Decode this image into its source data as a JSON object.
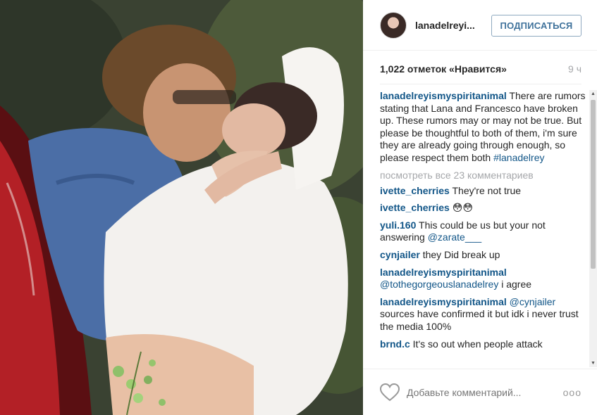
{
  "post": {
    "username": "lanadelreyi...",
    "follow_label": "ПОДПИСАТЬСЯ",
    "likes_text": "1,022 отметок «Нравится»",
    "time_ago": "9 ч"
  },
  "caption": {
    "user": "lanadelreyismyspiritanimal",
    "text": " There are rumors stating that Lana and Francesco have broken up. These rumors may or may not be true. But please be thoughtful to both of them, i'm sure they are already going through enough, so please respect them both ",
    "hashtag": "#lanadelrey"
  },
  "view_all_comments": "посмотреть все 23 комментариев",
  "comments": [
    {
      "user": "ivette_cherries",
      "text": " They're not true",
      "mention": ""
    },
    {
      "user": "ivette_cherries",
      "text": " 😳😳",
      "mention": ""
    },
    {
      "user": "yuli.160",
      "text": " This could be us but your not answering ",
      "mention": "@zarate___"
    },
    {
      "user": "cynjailer",
      "text": " they Did break up",
      "mention": ""
    },
    {
      "user": "lanadelreyismyspiritanimal",
      "text": " i agree",
      "mention": "@tothegorgeouslanadelrey"
    },
    {
      "user": "lanadelreyismyspiritanimal",
      "text": " sources have confirmed it but idk i never trust the media 100%",
      "mention": "@cynjailer"
    },
    {
      "user": "brnd.c",
      "text": " It's so out when people attack",
      "mention": ""
    }
  ],
  "footer": {
    "add_comment_placeholder": "Добавьте комментарий...",
    "more_label": "ooo"
  }
}
